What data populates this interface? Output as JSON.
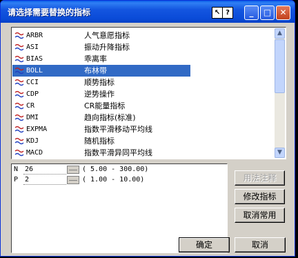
{
  "window": {
    "title": "请选择需要替换的指标",
    "help_glyph_1": "↖",
    "help_glyph_2": "?",
    "min_glyph": "_",
    "max_glyph": "□",
    "close_glyph": "✕"
  },
  "indicators": [
    {
      "code": "ARBR",
      "name": "人气意愿指标"
    },
    {
      "code": "ASI",
      "name": "振动升降指标"
    },
    {
      "code": "BIAS",
      "name": "乖离率"
    },
    {
      "code": "BOLL",
      "name": "布林带"
    },
    {
      "code": "CCI",
      "name": "顺势指标"
    },
    {
      "code": "CDP",
      "name": "逆势操作"
    },
    {
      "code": "CR",
      "name": "CR能量指标"
    },
    {
      "code": "DMI",
      "name": "趋向指标(标准)"
    },
    {
      "code": "EXPMA",
      "name": "指数平滑移动平均线"
    },
    {
      "code": "KDJ",
      "name": "随机指标"
    },
    {
      "code": "MACD",
      "name": "指数平滑异同平均线"
    }
  ],
  "selected_index": 3,
  "scroll": {
    "up": "▲",
    "down": "▼"
  },
  "params": [
    {
      "name": "N",
      "value": "26",
      "range": "( 5.00 - 300.00)"
    },
    {
      "name": "P",
      "value": "2",
      "range": "( 1.00 - 10.00)"
    }
  ],
  "buttons": {
    "usage": "用法注释",
    "modify": "修改指标",
    "cancel_common": "取消常用",
    "ok": "确定",
    "cancel": "取消"
  }
}
